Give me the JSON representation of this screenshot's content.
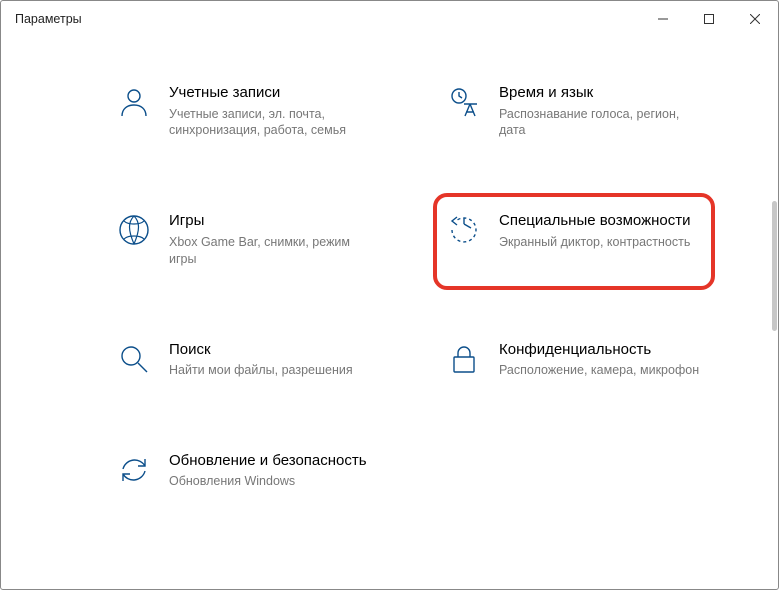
{
  "window": {
    "title": "Параметры"
  },
  "tiles": {
    "accounts": {
      "title": "Учетные записи",
      "desc": "Учетные записи, эл. почта, синхронизация, работа, семья"
    },
    "time": {
      "title": "Время и язык",
      "desc": "Распознавание голоса, регион, дата"
    },
    "gaming": {
      "title": "Игры",
      "desc": "Xbox Game Bar, снимки, режим игры"
    },
    "access": {
      "title": "Специальные возможности",
      "desc": "Экранный диктор, контрастность"
    },
    "search": {
      "title": "Поиск",
      "desc": "Найти мои файлы, разрешения"
    },
    "privacy": {
      "title": "Конфиденциальность",
      "desc": "Расположение, камера, микрофон"
    },
    "update": {
      "title": "Обновление и безопасность",
      "desc": "Обновления Windows"
    }
  }
}
